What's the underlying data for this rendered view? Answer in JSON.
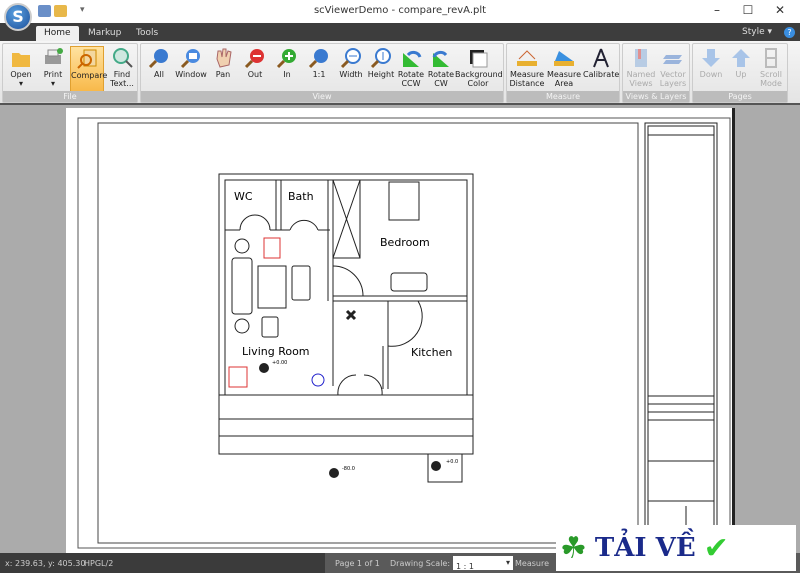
{
  "app": {
    "title": "scViewerDemo - compare_revA.plt"
  },
  "tabs": [
    "Home",
    "Markup",
    "Tools"
  ],
  "style_label": "Style",
  "groups": {
    "file": "File",
    "view": "View",
    "measure": "Measure",
    "views_layers": "Views & Layers",
    "pages": "Pages"
  },
  "buttons": {
    "open": "Open",
    "print": "Print",
    "compare": "Compare",
    "find": "Find Text...",
    "all": "All",
    "window": "Window",
    "pan": "Pan",
    "out": "Out",
    "in": "In",
    "one": "1:1",
    "width": "Width",
    "height": "Height",
    "rccw": "Rotate CCW",
    "rcw": "Rotate CW",
    "bg": "Background Color",
    "mdist": "Measure Distance",
    "marea": "Measure Area",
    "calib": "Calibrate",
    "named": "Named Views",
    "vlayers": "Vector Layers",
    "down": "Down",
    "up": "Up",
    "scroll": "Scroll Mode"
  },
  "rooms": {
    "wc": "WC",
    "bath": "Bath",
    "bedroom": "Bedroom",
    "living": "Living Room",
    "kitchen": "Kitchen"
  },
  "levels": [
    "+0.00",
    "-80.0",
    "+0.0"
  ],
  "status": {
    "coords": "x: 239.63, y: 405.30",
    "format": "HPGL/2",
    "page": "Page 1 of 1",
    "scale_label": "Drawing Scale:",
    "scale_value": "1 : 1",
    "measure": "Measure"
  },
  "watermark": "TẢI VỀ",
  "colors": {
    "accent": "#f8b94a",
    "tabbar": "#3d3d3d",
    "canvas": "#ababab"
  }
}
